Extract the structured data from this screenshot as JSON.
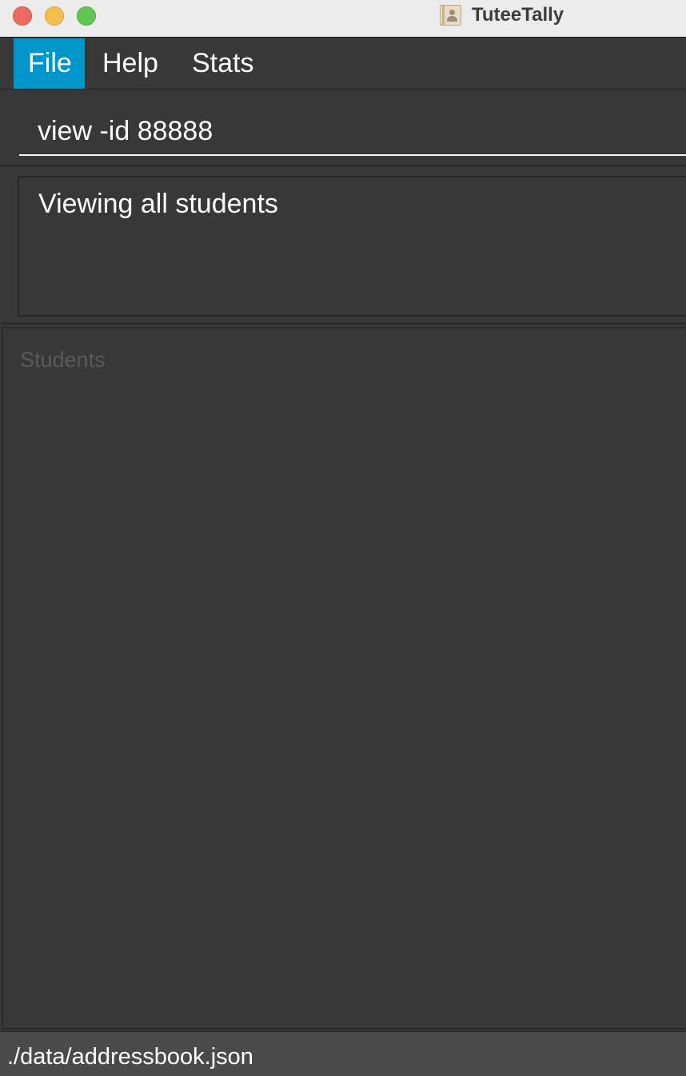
{
  "window": {
    "title": "TuteeTally"
  },
  "menubar": {
    "items": [
      {
        "label": "File"
      },
      {
        "label": "Help"
      },
      {
        "label": "Stats"
      }
    ]
  },
  "command_box": {
    "value": "view -id 88888"
  },
  "result_display": {
    "text": "Viewing all students"
  },
  "student_list": {
    "placeholder": "Students"
  },
  "status_bar": {
    "file_path": "./data/addressbook.json"
  },
  "colors": {
    "menu_active": "#0096c9",
    "background": "#383838",
    "status_bar": "#4a4a4a"
  }
}
